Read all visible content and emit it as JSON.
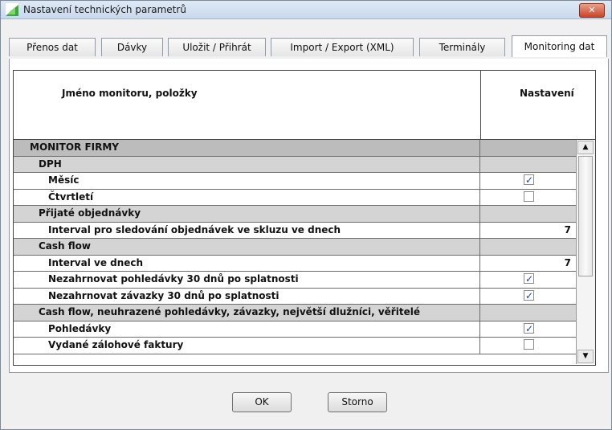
{
  "window": {
    "title": "Nastavení technických parametrů",
    "close_label": "✕"
  },
  "tabs": [
    {
      "label": "Přenos dat"
    },
    {
      "label": "Dávky"
    },
    {
      "label": "Uložit / Přihrát"
    },
    {
      "label": "Import / Export (XML)"
    },
    {
      "label": "Terminály"
    },
    {
      "label": "Monitoring dat",
      "active": true
    }
  ],
  "grid": {
    "header_name": "Jméno monitoru, položky",
    "header_setting": "Nastavení",
    "rows": [
      {
        "label": "MONITOR FIRMY",
        "type": "section",
        "level": 0
      },
      {
        "label": "DPH",
        "type": "group",
        "level": 1
      },
      {
        "label": "Měsíc",
        "type": "item",
        "level": 2,
        "checkbox": true,
        "checked": true
      },
      {
        "label": "Čtvrtletí",
        "type": "item",
        "level": 2,
        "checkbox": true,
        "checked": false
      },
      {
        "label": "Přijaté objednávky",
        "type": "group",
        "level": 1
      },
      {
        "label": "Interval pro sledování objednávek ve skluzu ve dnech",
        "type": "item",
        "level": 2,
        "value": "7"
      },
      {
        "label": "Cash flow",
        "type": "group",
        "level": 1
      },
      {
        "label": "Interval ve dnech",
        "type": "item",
        "level": 2,
        "value": "7"
      },
      {
        "label": "Nezahrnovat pohledávky 30 dnů po splatnosti",
        "type": "item",
        "level": 2,
        "checkbox": true,
        "checked": true
      },
      {
        "label": "Nezahrnovat závazky 30 dnů po splatnosti",
        "type": "item",
        "level": 2,
        "checkbox": true,
        "checked": true
      },
      {
        "label": "Cash flow, neuhrazené pohledávky, závazky, největší dlužníci, věřitelé",
        "type": "group",
        "level": 1
      },
      {
        "label": "Pohledávky",
        "type": "item",
        "level": 2,
        "checkbox": true,
        "checked": true
      },
      {
        "label": "Vydané zálohové faktury",
        "type": "item",
        "level": 2,
        "checkbox": true,
        "checked": false
      }
    ]
  },
  "buttons": {
    "ok": "OK",
    "cancel": "Storno"
  },
  "colors": {
    "section_bg": "#bcbcbc",
    "group_bg": "#d4d4d4",
    "check_color": "#1a3fb0",
    "close_red": "#c8452a"
  },
  "icons": {
    "app": "green-corner-app-icon",
    "scroll_up": "arrow-up-icon",
    "scroll_down": "arrow-down-icon"
  }
}
